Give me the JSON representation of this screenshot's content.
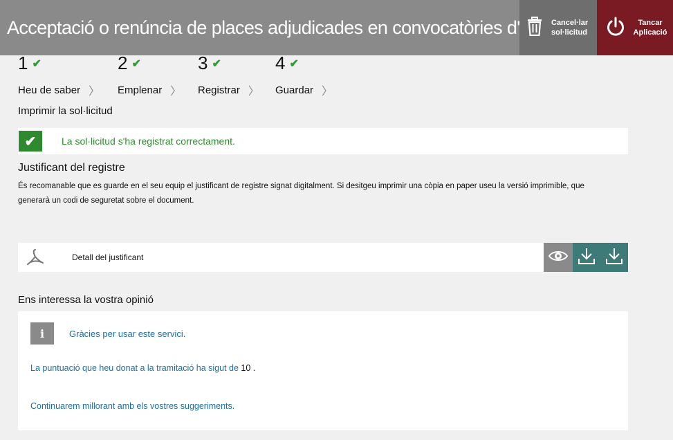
{
  "header": {
    "title": "Acceptació o renúncia de places adjudicades en convocatòries d'estabilit...",
    "cancel_label_line1": "Cancel·lar",
    "cancel_label_line2": "sol·licitud",
    "close_label_line1": "Tancar",
    "close_label_line2": "Aplicació"
  },
  "steps": [
    {
      "number": "1",
      "label": "Heu de saber"
    },
    {
      "number": "2",
      "label": "Emplenar"
    },
    {
      "number": "3",
      "label": "Registrar"
    },
    {
      "number": "4",
      "label": "Guardar"
    }
  ],
  "print_heading": "Imprimir la sol·licitud",
  "success_message": "La sol·licitud s'ha registrat correctament.",
  "justificant": {
    "title": "Justificant del registre",
    "description": "És recomanable que es guarde en el seu equip el justificant de registre signat digitalment. Si desitgeu imprimir una còpia en paper useu la versió imprimible, que generarà un codi de seguretat sobre el document.",
    "document_label": "Detall del justificant"
  },
  "opinion": {
    "title": "Ens interessa la vostra opinió",
    "thanks": "Gràcies per usar este servici.",
    "score_prefix": "La puntuació que heu donat a la tramitació ha sigut de",
    "score_value": "10",
    "score_suffix": ".",
    "continue_text": "Continuarem millorant amb els vostres suggeriments."
  },
  "icons": {
    "trash": "trash-icon",
    "power": "power-icon",
    "check": "check-icon",
    "pdf": "pdf-icon",
    "view": "eye-icon",
    "download": "download-icon",
    "info": "info-icon"
  },
  "colors": {
    "header_bg": "#8a8a8a",
    "cancel_bg": "#6e6e6e",
    "close_bg": "#7a1a23",
    "success_green": "#2f8a2f",
    "download_teal": "#3e7a77",
    "link_blue": "#1d6fa5"
  }
}
